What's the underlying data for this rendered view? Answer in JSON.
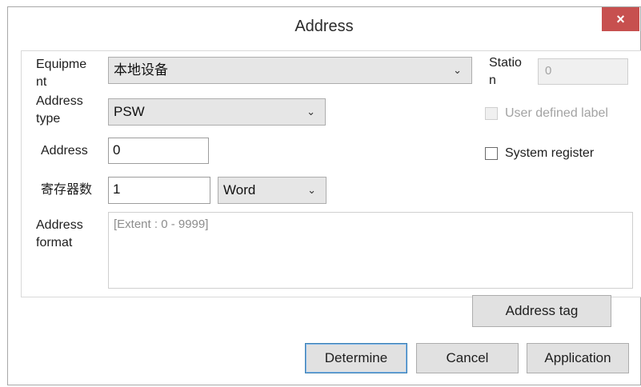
{
  "window": {
    "title": "Address",
    "close_glyph": "×"
  },
  "form": {
    "equipment": {
      "label": "Equipme\nnt",
      "value": "本地设备"
    },
    "station": {
      "label": "Statio\nn",
      "value": "0"
    },
    "address_type": {
      "label": "Address\ntype",
      "value": "PSW"
    },
    "user_defined_label": {
      "label": "User defined label",
      "checked": false,
      "enabled": false
    },
    "address": {
      "label": "Address",
      "value": "0"
    },
    "system_register": {
      "label": "System register",
      "checked": false
    },
    "register_count": {
      "label": "寄存器数",
      "value": "1",
      "unit": "Word"
    },
    "address_format": {
      "label": "Address\nformat",
      "value": "[Extent : 0 - 9999]"
    }
  },
  "buttons": {
    "address_tag": "Address tag",
    "determine": "Determine",
    "cancel": "Cancel",
    "application": "Application"
  },
  "icons": {
    "dropdown": "chevron-down-icon",
    "close": "close-icon"
  }
}
